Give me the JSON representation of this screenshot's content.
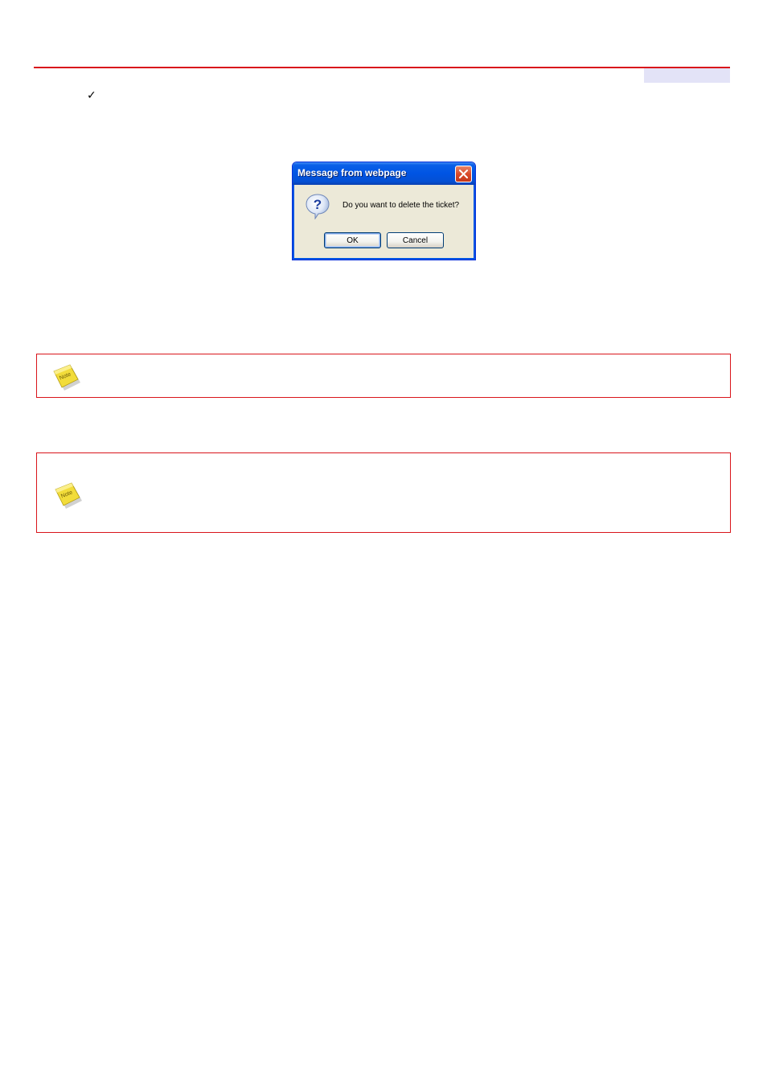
{
  "header": {
    "rule_color": "#d9141b",
    "tab_color": "#e3e3f7"
  },
  "bullet": {
    "check_glyph": "✓"
  },
  "dialog": {
    "title": "Message from webpage",
    "message": "Do you want to delete the ticket?",
    "ok_label": "OK",
    "cancel_label": "Cancel",
    "icon": "question-icon",
    "close_icon": "close-icon"
  },
  "notes": [
    {
      "icon": "note-icon"
    },
    {
      "icon": "note-icon"
    }
  ],
  "colors": {
    "accent_red": "#d9141b",
    "dialog_blue": "#0054e3",
    "dialog_face": "#ece9d8"
  }
}
